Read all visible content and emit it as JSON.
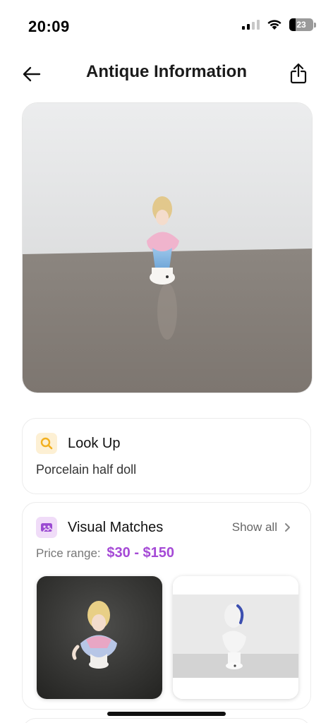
{
  "status_bar": {
    "time": "20:09",
    "battery": "23",
    "icons": [
      "cellular-signal-icon",
      "wifi-icon",
      "battery-icon"
    ]
  },
  "header": {
    "title": "Antique Information",
    "back_icon": "back-arrow-icon",
    "share_icon": "share-icon"
  },
  "lookup": {
    "title": "Look Up",
    "result": "Porcelain half doll",
    "icon": "magnifier-icon",
    "icon_color": "#f2b020"
  },
  "visual_matches": {
    "title": "Visual Matches",
    "show_all_label": "Show all",
    "price_label": "Price range:",
    "price_value": "$30 - $150",
    "icon": "image-match-icon",
    "icon_color": "#9b4bd2",
    "price_color": "#a54ad6",
    "thumbnails": [
      {
        "name": "match-thumbnail-1",
        "subject": "porcelain-half-doll"
      },
      {
        "name": "match-thumbnail-2",
        "subject": "white-porcelain-half-doll"
      }
    ]
  }
}
